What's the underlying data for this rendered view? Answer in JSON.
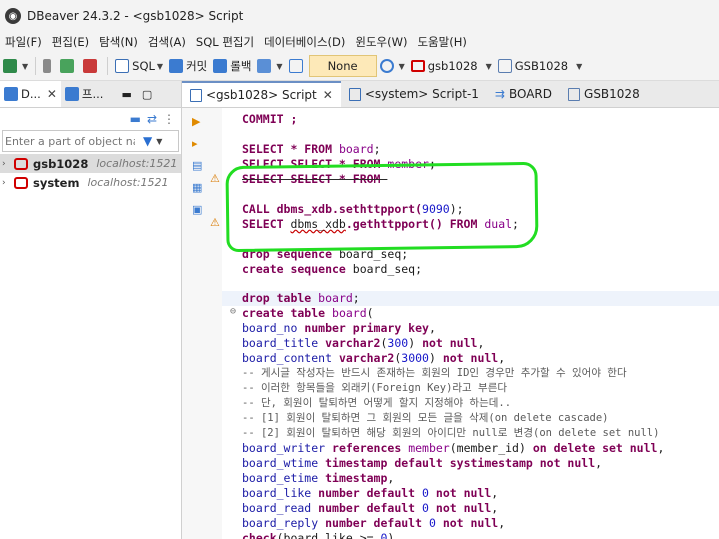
{
  "window": {
    "title": "DBeaver 24.3.2 - <gsb1028> Script"
  },
  "menu": [
    "파일(F)",
    "편집(E)",
    "탐색(N)",
    "검색(A)",
    "SQL 편집기",
    "데이터베이스(D)",
    "윈도우(W)",
    "도움말(H)"
  ],
  "toolbar": {
    "sql_label": "SQL",
    "commit_label": "커밋",
    "rollback_label": "롤백",
    "transaction_mode": "None",
    "datasource": "gsb1028",
    "schema": "GSB1028"
  },
  "navigator": {
    "tab1": "D...",
    "tab2": "프...",
    "filter_placeholder": "Enter a part of object nan",
    "connections": [
      {
        "name": "gsb1028",
        "host": "localhost:1521"
      },
      {
        "name": "system",
        "host": "localhost:1521"
      }
    ]
  },
  "editor_tabs": [
    "<gsb1028> Script",
    "<system> Script-1",
    "BOARD",
    "GSB1028"
  ],
  "code": {
    "l01": "COMMIT ;",
    "l02a": "SELECT * FROM ",
    "l02b": "board",
    "l02c": ";",
    "l03a": "SELECT SELECT * FROM ",
    "l03b": "member",
    "l03c": ";",
    "l04": "SELECT SELECT * FROM ",
    "l05a": "CALL dbms_xdb.sethttpport(",
    "l05b": "9090",
    "l05c": ");",
    "l06a": "SELECT ",
    "l06b": "dbms_xdb",
    "l06c": ".gethttpport() FROM ",
    "l06d": "dual",
    "l06e": ";",
    "l07a": "drop sequence ",
    "l07b": "board_seq;",
    "l08a": "create sequence ",
    "l08b": "board_seq;",
    "l09a": "drop table ",
    "l09b": "board",
    "l09c": ";",
    "l10a": "create table ",
    "l10b": "board",
    "l10c": "(",
    "l11a": "board_no ",
    "l11b": "number primary key",
    "l11c": ",",
    "l12a": "board_title ",
    "l12b": "varchar2",
    "l12c": "(",
    "l12d": "300",
    "l12e": ") ",
    "l12f": "not null",
    "l12g": ",",
    "l13a": "board_content ",
    "l13b": "varchar2",
    "l13c": "(",
    "l13d": "3000",
    "l13e": ") ",
    "l13f": "not null",
    "l13g": ",",
    "c1": "-- 게시글 작성자는 반드시 존재하는 회원의 ID인 경우만 추가할 수 있어야 한다",
    "c2": "-- 이러한 항목들을 외래키(Foreign Key)라고 부른다",
    "c3": "-- 단, 회원이 탈퇴하면 어떻게 할지 지정해야 하는데..",
    "c4": "-- [1] 회원이 탈퇴하면 그 회원의 모든 글을 삭제(on delete cascade)",
    "c5": "-- [2] 회원이 탈퇴하면 해당 회원의 아이디만 null로 변경(on delete set null)",
    "l14a": "board_writer ",
    "l14b": "references ",
    "l14c": "member",
    "l14d": "(member_id) ",
    "l14e": "on delete set null",
    "l14f": ",",
    "l15a": "board_wtime ",
    "l15b": "timestamp default systimestamp not null",
    "l15c": ",",
    "l16a": "board_etime ",
    "l16b": "timestamp",
    "l16c": ",",
    "l17a": "board_like ",
    "l17b": "number default ",
    "l17c": "0",
    "l17d": " not null",
    "l17e": ",",
    "l18a": "board_read ",
    "l18b": "number default ",
    "l18c": "0",
    "l18d": " not null",
    "l18e": ",",
    "l19a": "board_reply ",
    "l19b": "number default ",
    "l19c": "0",
    "l19d": " not null",
    "l19e": ",",
    "l20a": "check",
    "l20b": "(board_like >= ",
    "l20c": "0",
    "l20d": ")"
  },
  "colors": {
    "annotation": "#22dd22",
    "keyword": "#7f0055",
    "error": "#c80000"
  }
}
